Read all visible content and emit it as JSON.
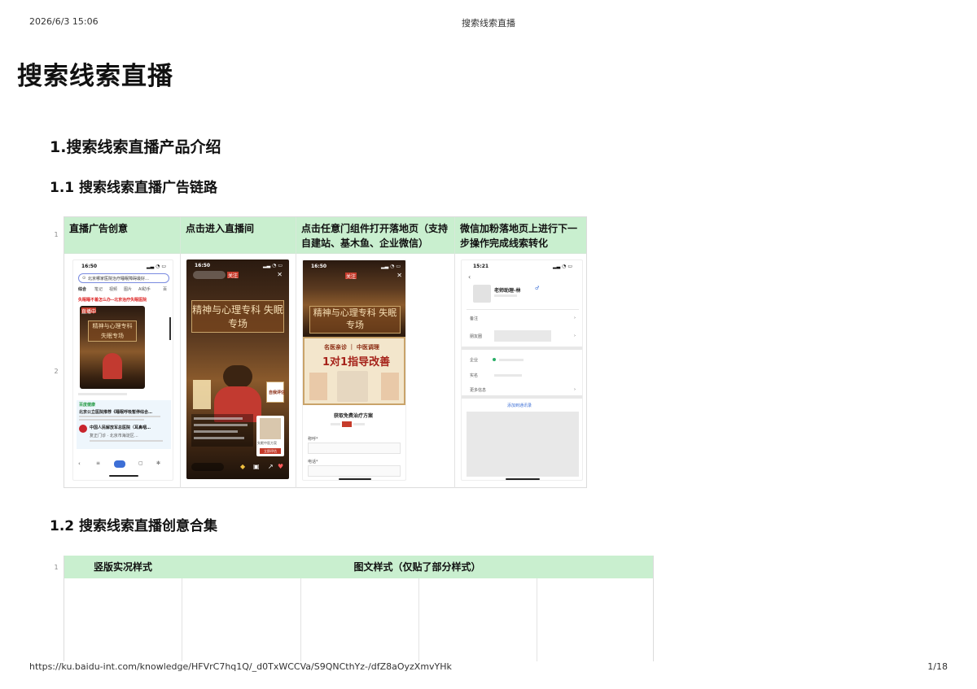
{
  "print_header": {
    "datetime": "2026/6/3 15:06",
    "title": "搜索线索直播"
  },
  "print_footer": {
    "url": "https://ku.baidu-int.com/knowledge/HFVrC7hq1Q/_d0TxWCCVa/S9QNCthYz-/dfZ8aOyzXmvYHk",
    "page": "1/18"
  },
  "doc": {
    "title": "搜索线索直播",
    "section1": "1.搜索线索直播产品介绍",
    "sub1": "1.1 搜索线索直播广告链路",
    "sub2": "1.2 搜索线索直播创意合集"
  },
  "table1": {
    "row_numbers": [
      "1",
      "2"
    ],
    "headers": [
      "直播广告创意",
      "点击进入直播间",
      "点击任意门组件打开落地页（支持自建站、基木鱼、企业微信）",
      "微信加粉落地页上进行下一步操作完成线索转化"
    ],
    "screens": {
      "s1": {
        "time": "16:50",
        "search": "北京哪家医院治疗睡眠障碍最好…",
        "tabs": [
          "综合",
          "笔记",
          "视频",
          "图片",
          "AI助手",
          "百"
        ],
        "headline": "失眠睡不着怎么办--北京治疗失眠医院",
        "live_badge": "直播中",
        "banner": "精神与心理专科 失眠专场",
        "brand": "百度健康",
        "result1": "北京公立医院推荐《睡眠呼吸暂停综合…",
        "result2": "中国人民解放军总医院（耳鼻咽…",
        "result3": "复正门诊 · 北京市海淀区…"
      },
      "s2": {
        "time": "16:50",
        "banner": "精神与心理专科 失眠专场",
        "side_card": "自我评估",
        "card_label": "失眠中医方案",
        "btn": "立即评估"
      },
      "s3": {
        "time": "16:50",
        "banner": "精神与心理专科 失眠专场",
        "card_tag": "名医亲诊 ｜ 中医调理",
        "card_title": "1对1指导改善",
        "form_title": "获取免费治疗方案",
        "field_name": "称呼*",
        "field_phone": "电话*"
      },
      "s4": {
        "time": "15:21",
        "contact": "老师助理-林",
        "rows": [
          "备注",
          "朋友圈",
          "企业",
          "实名",
          "更多信息"
        ],
        "add_btn": "添加到通讯录"
      }
    }
  },
  "table2": {
    "row_numbers": [
      "1"
    ],
    "headers": [
      "竖版实况样式",
      "图文样式（仅贴了部分样式）"
    ]
  },
  "colors": {
    "header_green": "#c9efcf",
    "live_red": "#c63b2b",
    "wechat_blue": "#3d6fd6"
  }
}
